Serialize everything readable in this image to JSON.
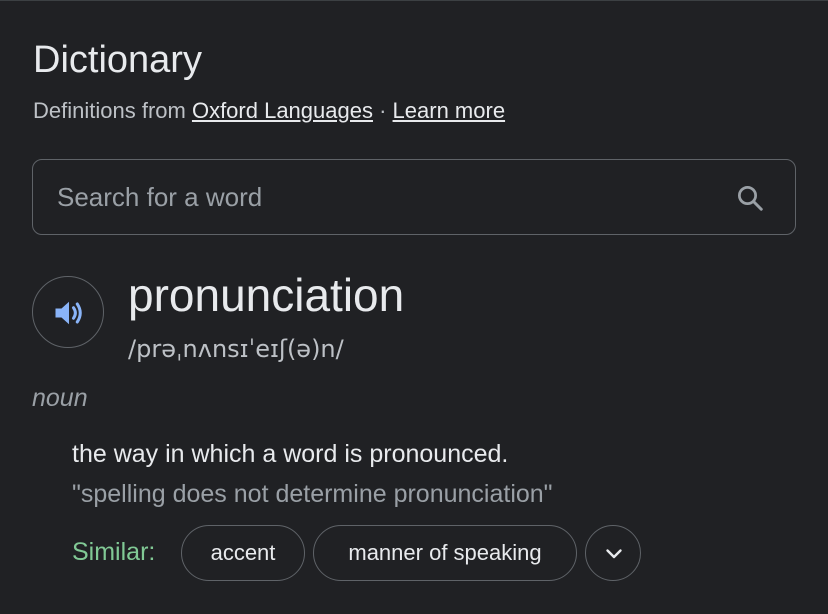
{
  "header": {
    "title": "Dictionary",
    "source_prefix": "Definitions from ",
    "source_link": "Oxford Languages",
    "separator": " · ",
    "learn_more": "Learn more"
  },
  "search": {
    "placeholder": "Search for a word",
    "value": "",
    "icon": "search-icon"
  },
  "entry": {
    "audio_icon": "speaker-icon",
    "word": "pronunciation",
    "phonetic": "/prəˌnʌnsɪˈeɪʃ(ə)n/",
    "part_of_speech": "noun",
    "definition": "the way in which a word is pronounced.",
    "example": "\"spelling does not determine pronunciation\"",
    "similar_label": "Similar:",
    "similar": [
      "accent",
      "manner of speaking"
    ],
    "expand_icon": "chevron-down-icon"
  },
  "colors": {
    "background": "#202124",
    "text_primary": "#e8eaed",
    "text_secondary": "#9aa0a6",
    "border": "#5f6368",
    "similar_label": "#81c995",
    "speaker_icon": "#8ab4f8"
  }
}
